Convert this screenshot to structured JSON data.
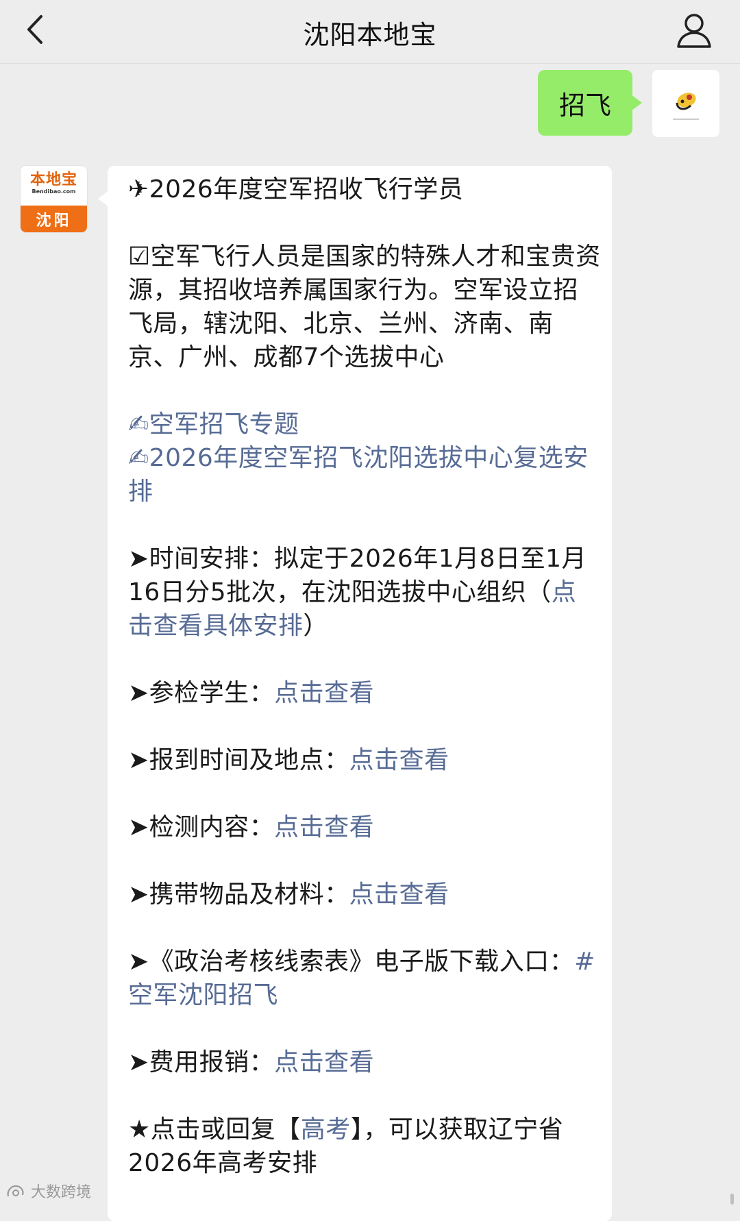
{
  "header": {
    "title": "沈阳本地宝"
  },
  "sent_message": {
    "text": "招飞"
  },
  "account": {
    "logo_text": "本地宝",
    "logo_url": "Bendibao.com",
    "city": "沈阳"
  },
  "article": {
    "headline": "✈2026年度空军招收飞行学员",
    "intro": "☑空军飞行人员是国家的特殊人才和宝贵资源，其招收培养属国家行为。空军设立招飞局，辖沈阳、北京、兰州、济南、南京、广州、成都7个选拔中心",
    "link_topic": "✍空军招飞专题",
    "link_review": "✍2026年度空军招飞沈阳选拔中心复选安排",
    "schedule_prefix": "➤时间安排：拟定于2026年1月8日至1月16日分5批次，在沈阳选拔中心组织（",
    "schedule_link": "点击查看具体安排",
    "schedule_suffix": "）",
    "items": [
      {
        "label": "➤参检学生：",
        "link": "点击查看"
      },
      {
        "label": "➤报到时间及地点：",
        "link": "点击查看"
      },
      {
        "label": "➤检测内容：",
        "link": "点击查看"
      },
      {
        "label": "➤携带物品及材料：",
        "link": "点击查看"
      }
    ],
    "download_label": "➤《政治考核线索表》电子版下载入口：",
    "download_link": "#空军沈阳招飞",
    "expense_label": "➤费用报销：",
    "expense_link": "点击查看",
    "gaokao_prefix": "★点击或回复【",
    "gaokao_link": "高考",
    "gaokao_suffix": "】，可以获取辽宁省2026年高考安排"
  },
  "watermark": "大数跨境",
  "colors": {
    "background": "#ededed",
    "sent_bubble": "#95ec69",
    "link": "#576b95",
    "brand_orange": "#ef6f16"
  }
}
